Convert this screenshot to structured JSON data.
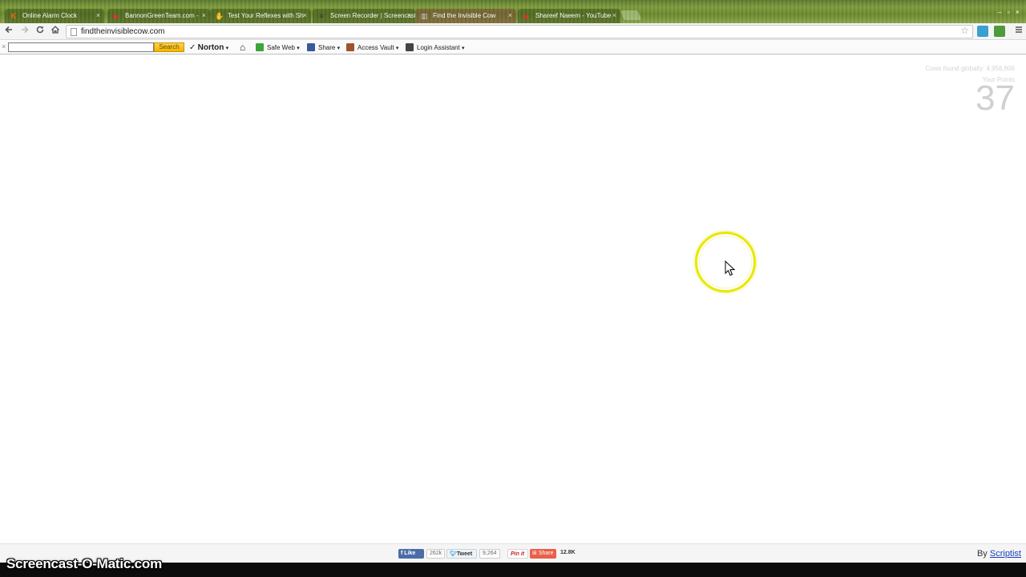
{
  "browser": {
    "tabs": [
      {
        "label": "Online Alarm Clock",
        "icon": "K",
        "icon_color": "#ff6a00"
      },
      {
        "label": "BannonGreenTeam.com -",
        "icon": "▶",
        "icon_color": "#e52d27"
      },
      {
        "label": "Test Your Reflexes with Sh",
        "icon": "✋",
        "icon_color": "#f2c020"
      },
      {
        "label": "Screen Recorder | Screencast",
        "icon": "≡",
        "icon_color": "#333333"
      },
      {
        "label": "Find the Invisible Cow",
        "icon": "▥",
        "icon_color": "#d0d0d0"
      },
      {
        "label": "Shareef Naeem - YouTube",
        "icon": "▶",
        "icon_color": "#e52d27"
      }
    ],
    "tab_close": "×",
    "window_controls": [
      "–",
      "▫",
      "×"
    ],
    "url": "findtheinvisiblecow.com",
    "star": "☆"
  },
  "norton": {
    "close": "×",
    "search_value": "",
    "search_label": "Search",
    "brand": "Norton",
    "items": {
      "safe_web": "Safe Web",
      "share": "Share",
      "access_vault": "Access Vault",
      "login_assistant": "Login Assistant"
    },
    "home_icon": "⌂"
  },
  "game": {
    "cows_found": "Cows found globally: 4,956,906",
    "points_label": "Your Points",
    "points": "37"
  },
  "footer": {
    "like_label": "Like",
    "like_count": "262k",
    "tweet_label": "Tweet",
    "tweet_count": "9,264",
    "pin_label": "Pin it",
    "share_label": "Share",
    "share_count": "12.8K",
    "by_text": "By",
    "by_link": "Scriptist"
  },
  "watermark": "Screencast-O-Matic.com",
  "colors": {
    "ring": "#e8e800",
    "norton_button": "#f2b400",
    "facebook": "#4c6ca8",
    "link": "#1a3fc0"
  }
}
